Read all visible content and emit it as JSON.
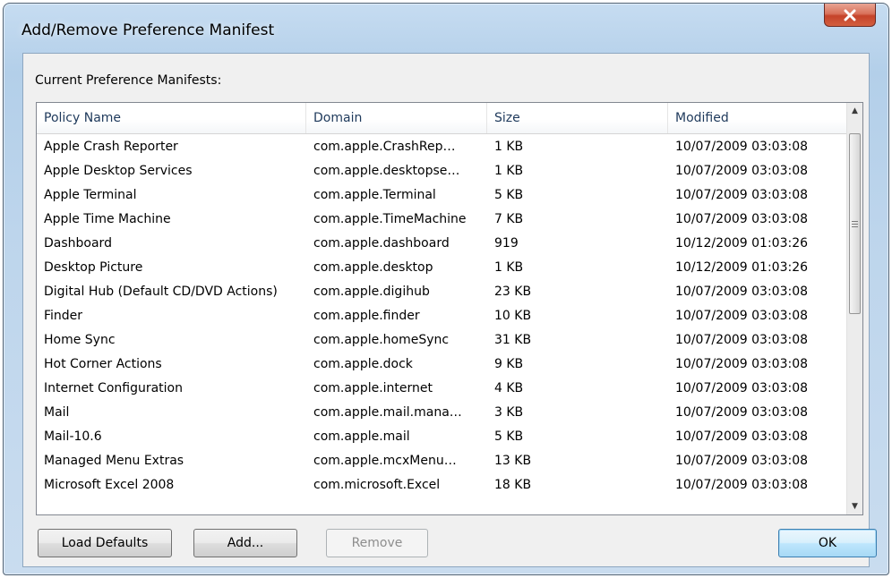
{
  "window": {
    "title": "Add/Remove Preference Manifest",
    "close_icon": "close-icon"
  },
  "section_label": "Current Preference Manifests:",
  "columns": [
    "Policy Name",
    "Domain",
    "Size",
    "Modified"
  ],
  "rows": [
    [
      "Apple Crash Reporter",
      "com.apple.CrashRep…",
      "1 KB",
      "10/07/2009 03:03:08"
    ],
    [
      "Apple Desktop Services",
      "com.apple.desktopse…",
      "1 KB",
      "10/07/2009 03:03:08"
    ],
    [
      "Apple Terminal",
      "com.apple.Terminal",
      "5 KB",
      "10/07/2009 03:03:08"
    ],
    [
      "Apple Time Machine",
      "com.apple.TimeMachine",
      "7 KB",
      "10/07/2009 03:03:08"
    ],
    [
      "Dashboard",
      "com.apple.dashboard",
      "919",
      "10/12/2009 01:03:26"
    ],
    [
      "Desktop Picture",
      "com.apple.desktop",
      "1 KB",
      "10/12/2009 01:03:26"
    ],
    [
      "Digital Hub (Default CD/DVD Actions)",
      "com.apple.digihub",
      "23 KB",
      "10/07/2009 03:03:08"
    ],
    [
      "Finder",
      "com.apple.finder",
      "10 KB",
      "10/07/2009 03:03:08"
    ],
    [
      "Home Sync",
      "com.apple.homeSync",
      "31 KB",
      "10/07/2009 03:03:08"
    ],
    [
      "Hot Corner Actions",
      "com.apple.dock",
      "9 KB",
      "10/07/2009 03:03:08"
    ],
    [
      "Internet Configuration",
      "com.apple.internet",
      "4 KB",
      "10/07/2009 03:03:08"
    ],
    [
      "Mail",
      "com.apple.mail.mana…",
      "3 KB",
      "10/07/2009 03:03:08"
    ],
    [
      "Mail-10.6",
      "com.apple.mail",
      "5 KB",
      "10/07/2009 03:03:08"
    ],
    [
      "Managed Menu Extras",
      "com.apple.mcxMenu…",
      "13 KB",
      "10/07/2009 03:03:08"
    ],
    [
      "Microsoft Excel 2008",
      "com.microsoft.Excel",
      "18 KB",
      "10/07/2009 03:03:08"
    ]
  ],
  "buttons": {
    "load_defaults": "Load Defaults",
    "add": "Add...",
    "remove": "Remove",
    "ok": "OK"
  },
  "colors": {
    "title_bar": "#b9d1ea",
    "close_button": "#c94a31",
    "header_text": "#1e395b",
    "disabled_text": "#8d8d8d"
  }
}
